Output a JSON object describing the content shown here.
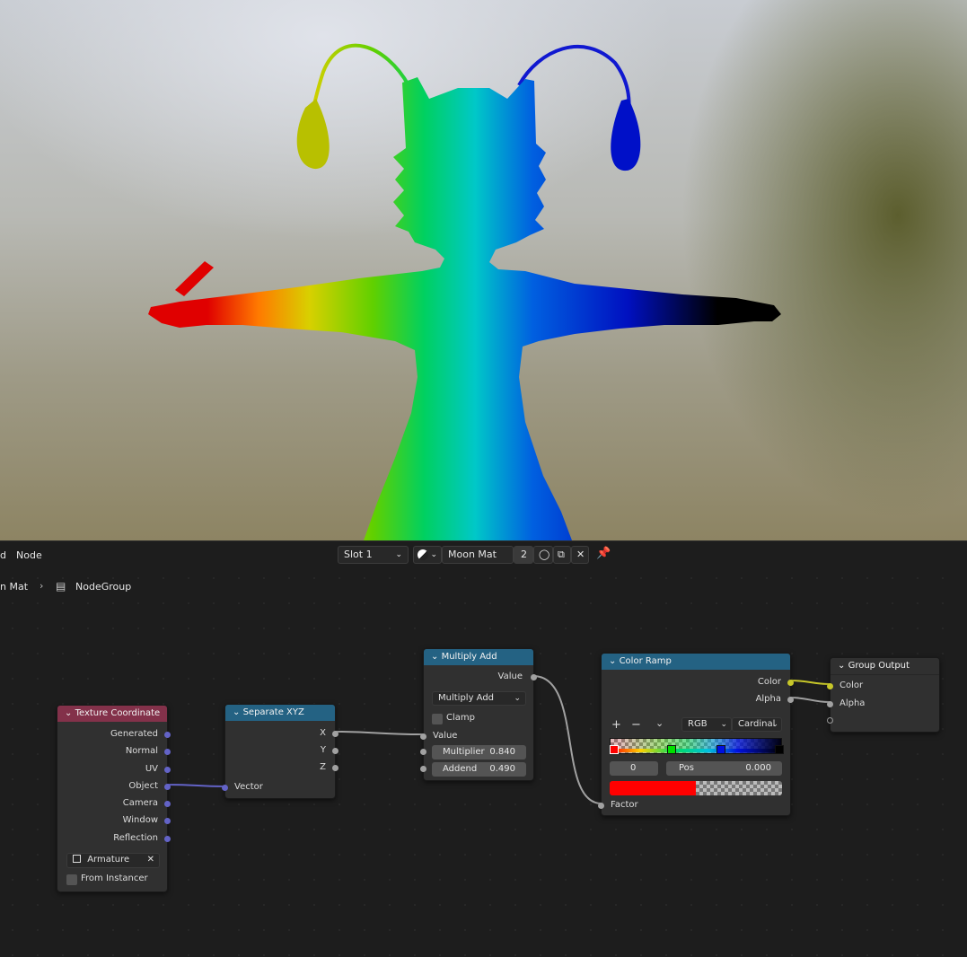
{
  "header": {
    "menu_partial": "d",
    "menu_node": "Node",
    "slot_label": "Slot 1",
    "material_name": "Moon Mat",
    "user_count": "2"
  },
  "breadcrumb": {
    "parent": "n Mat",
    "current": "NodeGroup"
  },
  "nodes": {
    "texture_coordinate": {
      "title": "Texture Coordinate",
      "outputs": [
        "Generated",
        "Normal",
        "UV",
        "Object",
        "Camera",
        "Window",
        "Reflection"
      ],
      "object_value": "Armature",
      "from_instancer": "From Instancer"
    },
    "separate_xyz": {
      "title": "Separate XYZ",
      "outputs": [
        "X",
        "Y",
        "Z"
      ],
      "input": "Vector"
    },
    "multiply_add": {
      "title": "Multiply Add",
      "output": "Value",
      "operation": "Multiply Add",
      "clamp": "Clamp",
      "input": "Value",
      "multiplier_label": "Multiplier",
      "multiplier_value": "0.840",
      "addend_label": "Addend",
      "addend_value": "0.490"
    },
    "color_ramp": {
      "title": "Color Ramp",
      "outputs": [
        "Color",
        "Alpha"
      ],
      "color_mode": "RGB",
      "interpolation": "Cardinal",
      "stop_index": "0",
      "pos_label": "Pos",
      "pos_value": "0.000",
      "input": "Factor",
      "stop_color": "#ff0000"
    },
    "group_output": {
      "title": "Group Output",
      "inputs": [
        "Color",
        "Alpha"
      ]
    }
  },
  "colors": {
    "vector_socket": "#6363c7",
    "float_socket": "#a1a1a1",
    "color_socket": "#c7c729",
    "input_header": "#83314a",
    "converter_header": "#246283",
    "output_header": "#3c3c3c"
  }
}
